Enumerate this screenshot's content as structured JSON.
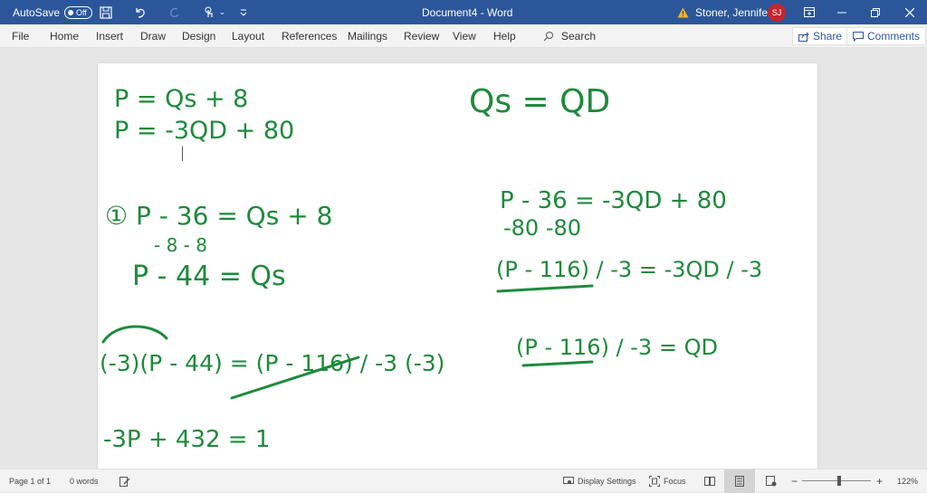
{
  "titlebar": {
    "autosave_label": "AutoSave",
    "autosave_state": "Off",
    "document_title": "Document4  -  Word",
    "user_name": "Stoner, Jennifer L",
    "user_initials": "SJ",
    "icons": [
      "save-icon",
      "undo-icon",
      "redo-icon",
      "touch-mode-icon",
      "customize-toolbar-icon",
      "warning-icon",
      "ribbon-display-icon",
      "minimize-icon",
      "restore-icon",
      "close-icon"
    ]
  },
  "ribbon": {
    "tabs": [
      "File",
      "Home",
      "Insert",
      "Draw",
      "Design",
      "Layout",
      "References",
      "Mailings",
      "Review",
      "View",
      "Help"
    ],
    "search_label": "Search",
    "share_label": "Share",
    "comments_label": "Comments"
  },
  "document": {
    "ink_color": "#1e8a3c",
    "handwriting": {
      "left": [
        "P = Qs + 8",
        "P = -3QD + 80",
        "① P - 36 = Qs + 8",
        "- 8            - 8",
        "P - 44 = Qs",
        "(-3)(P - 44) = (P - 116) / -3  (-3)",
        "-3P + 432 = 1"
      ],
      "right": [
        "Qs = QD",
        "P - 36 = -3QD + 80",
        "-80          -80",
        "(P - 116) / -3 = -3QD / -3",
        "(P - 116) / -3 = QD"
      ]
    }
  },
  "statusbar": {
    "page_info": "Page 1 of 1",
    "word_count": "0 words",
    "display_settings": "Display Settings",
    "focus": "Focus",
    "zoom_minus": "−",
    "zoom_plus": "+",
    "zoom_level": "122%",
    "zoom_value_percent": 122
  }
}
